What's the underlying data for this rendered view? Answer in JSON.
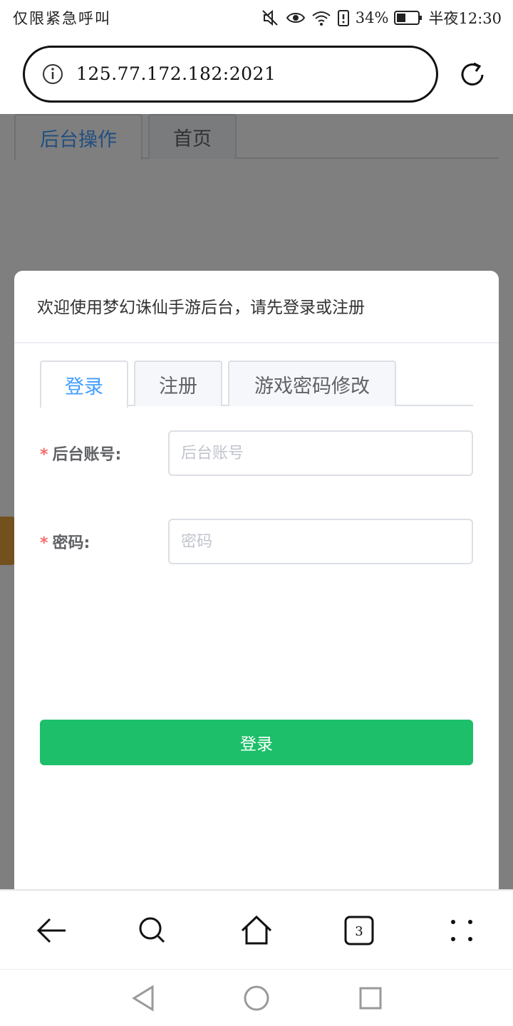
{
  "status_bar": {
    "carrier": "仅限紧急呼叫",
    "battery": "34%",
    "time": "半夜12:30"
  },
  "url_bar": {
    "url": "125.77.172.182:2021",
    "info_icon": "info-icon",
    "reload_icon": "reload-icon"
  },
  "page": {
    "tabs": [
      {
        "label": "后台操作",
        "active": true
      },
      {
        "label": "首页",
        "active": false
      }
    ]
  },
  "dialog": {
    "title": "欢迎使用梦幻诛仙手游后台，请先登录或注册",
    "tabs": [
      {
        "label": "登录",
        "active": true
      },
      {
        "label": "注册",
        "active": false
      },
      {
        "label": "游戏密码修改",
        "active": false
      }
    ],
    "form": {
      "account": {
        "required_mark": "*",
        "label": "后台账号:",
        "placeholder": "后台账号",
        "value": ""
      },
      "password": {
        "required_mark": "*",
        "label": "密码:",
        "placeholder": "密码",
        "value": ""
      },
      "submit_label": "登录"
    }
  },
  "toolbar": {
    "icons": [
      "back-arrow-icon",
      "search-icon",
      "home-icon",
      "tabs-icon",
      "more-icon"
    ],
    "tab_count": "3"
  },
  "colors": {
    "accent": "#409eff",
    "submit": "#1dbf6a",
    "required": "#f56c6c"
  }
}
